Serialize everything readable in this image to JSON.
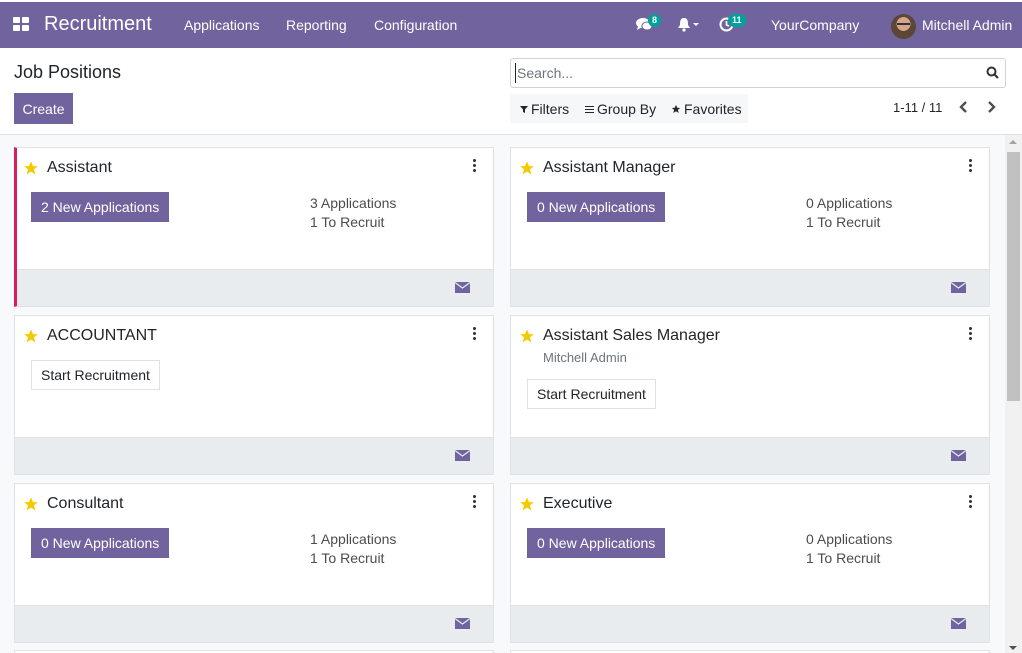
{
  "navbar": {
    "app_name": "Recruitment",
    "menu": [
      "Applications",
      "Reporting",
      "Configuration"
    ],
    "messages_count": "8",
    "activities_count": "11",
    "company": "YourCompany",
    "user": "Mitchell Admin",
    "icons": [
      "apps-grid-icon",
      "chat-icon",
      "bell-icon",
      "clock-icon"
    ]
  },
  "control_panel": {
    "title": "Job Positions",
    "create_label": "Create",
    "search_placeholder": "Search...",
    "filters_label": "Filters",
    "group_by_label": "Group By",
    "favorites_label": "Favorites",
    "pager": "1-11 / 11"
  },
  "cards": [
    {
      "title": "Assistant",
      "new_apps": "2 New Applications",
      "applications": "3 Applications",
      "to_recruit": "1 To Recruit",
      "highlight": true
    },
    {
      "title": "Assistant Manager",
      "new_apps": "0 New Applications",
      "applications": "0 Applications",
      "to_recruit": "1 To Recruit"
    },
    {
      "title": "ACCOUNTANT",
      "start_label": "Start Recruitment"
    },
    {
      "title": "Assistant Sales Manager",
      "subtitle": "Mitchell Admin",
      "start_label": "Start Recruitment"
    },
    {
      "title": "Consultant",
      "new_apps": "0 New Applications",
      "applications": "1 Applications",
      "to_recruit": "1 To Recruit"
    },
    {
      "title": "Executive",
      "new_apps": "0 New Applications",
      "applications": "0 Applications",
      "to_recruit": "1 To Recruit"
    }
  ],
  "colors": {
    "brand": "#71639e",
    "highlight": "#d91d62",
    "star": "#f3cc00",
    "badge": "#00a09d"
  }
}
